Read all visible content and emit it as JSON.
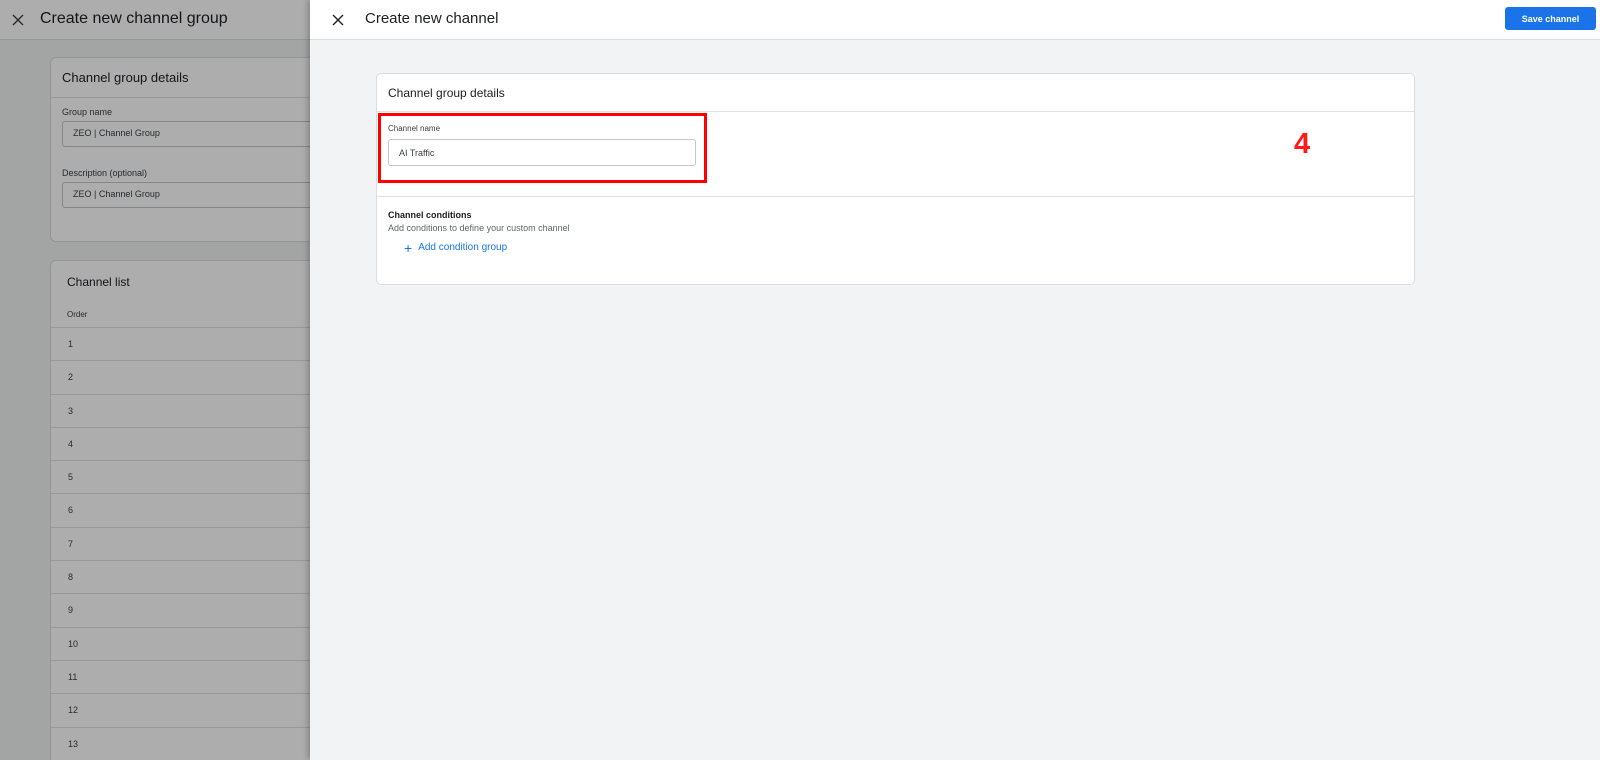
{
  "background": {
    "title": "Create new channel group",
    "details_card": {
      "title": "Channel group details",
      "group_name_label": "Group name",
      "group_name_value": "ZEO | Channel Group",
      "description_label": "Description (optional)",
      "description_value": "ZEO | Channel Group"
    },
    "channel_list": {
      "title": "Channel list",
      "order_header": "Order",
      "rows": [
        "1",
        "2",
        "3",
        "4",
        "5",
        "6",
        "7",
        "8",
        "9",
        "10",
        "11",
        "12",
        "13"
      ]
    }
  },
  "panel": {
    "title": "Create new channel",
    "save_label": "Save channel",
    "card_title": "Channel group details",
    "channel_name_label": "Channel name",
    "channel_name_value": "AI Traffic",
    "conditions_title": "Channel conditions",
    "conditions_desc": "Add conditions to define your custom channel",
    "add_condition_label": "Add condition group"
  },
  "annotation": {
    "step_number": "4",
    "color": "#ff0000"
  },
  "colors": {
    "accent": "#1a73e8",
    "background": "#f1f3f4"
  }
}
